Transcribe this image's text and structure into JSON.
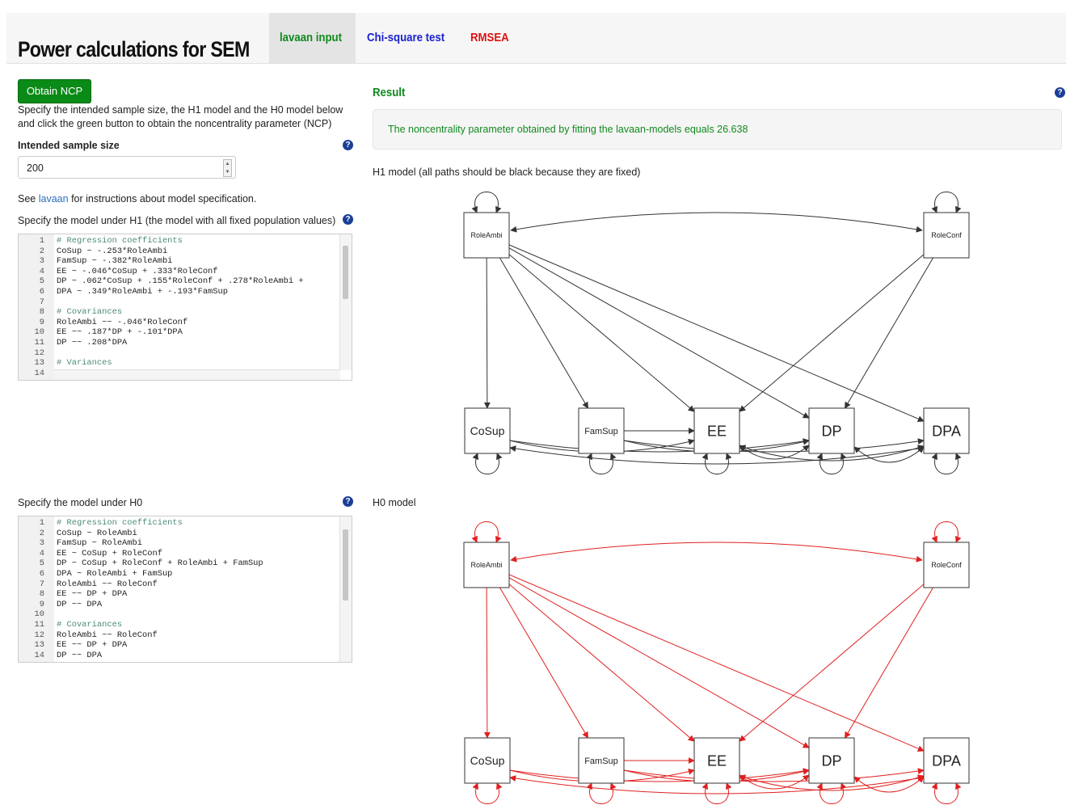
{
  "app": {
    "title": "Power calculations for SEM",
    "tabs": [
      {
        "label": "lavaan input",
        "color": "#118a1e",
        "active": true
      },
      {
        "label": "Chi-square test",
        "color": "#1a22cc"
      },
      {
        "label": "RMSEA",
        "color": "#e01010"
      }
    ]
  },
  "left": {
    "obtain_button": "Obtain NCP",
    "instructions_line1": "Specify the intended sample size, the H1 model and the H0 model below",
    "instructions_line2": "and click the green button to obtain the noncentrality parameter (NCP)",
    "sample_size_label": "Intended sample size",
    "sample_size_value": "200",
    "see_prefix": "See",
    "see_link": "lavaan",
    "see_suffix": "for instructions about model specification.",
    "h1_label": "Specify the model under H1 (the model with all fixed population values)",
    "h0_label": "Specify the model under H0",
    "h1_code": [
      "# Regression coefficients",
      "CoSup ~ -.253*RoleAmbi",
      "FamSup ~ -.382*RoleAmbi",
      "EE ~ -.046*CoSup + .333*RoleConf",
      "DP ~ .062*CoSup + .155*RoleConf + .278*RoleAmbi +",
      "DPA ~ .349*RoleAmbi + -.193*FamSup",
      "",
      "# Covariances",
      "RoleAmbi ~~ -.046*RoleConf",
      "EE ~~ .187*DP + -.101*DPA",
      "DP ~~ .208*DPA",
      "",
      "# Variances",
      ""
    ],
    "h0_code": [
      "# Regression coefficients",
      "CoSup ~ RoleAmbi",
      "FamSup ~ RoleAmbi",
      "EE ~ CoSup + RoleConf",
      "DP ~ CoSup + RoleConf + RoleAmbi + FamSup",
      "DPA ~ RoleAmbi + FamSup",
      "RoleAmbi ~~ RoleConf",
      "EE ~~ DP + DPA",
      "DP ~~ DPA",
      "",
      "# Covariances",
      "RoleAmbi ~~ RoleConf",
      "EE ~~ DP + DPA",
      "DP ~~ DPA"
    ]
  },
  "right": {
    "result_title": "Result",
    "result_text": "The noncentrality parameter obtained by fitting the lavaan-models equals 26.638",
    "h1_caption": "H1 model (all paths should be black because they are fixed)",
    "h0_caption": "H0 model",
    "h1_color": "#333333",
    "h0_color": "#e02020",
    "nodes": {
      "RoleAmbi": "RoleAmbi",
      "RoleConf": "RoleConf",
      "CoSup": "CoSup",
      "FamSup": "FamSup",
      "EE": "EE",
      "DP": "DP",
      "DPA": "DPA"
    }
  },
  "icons": {
    "help": "question-circle-icon",
    "spinner": "spinner-icon"
  }
}
